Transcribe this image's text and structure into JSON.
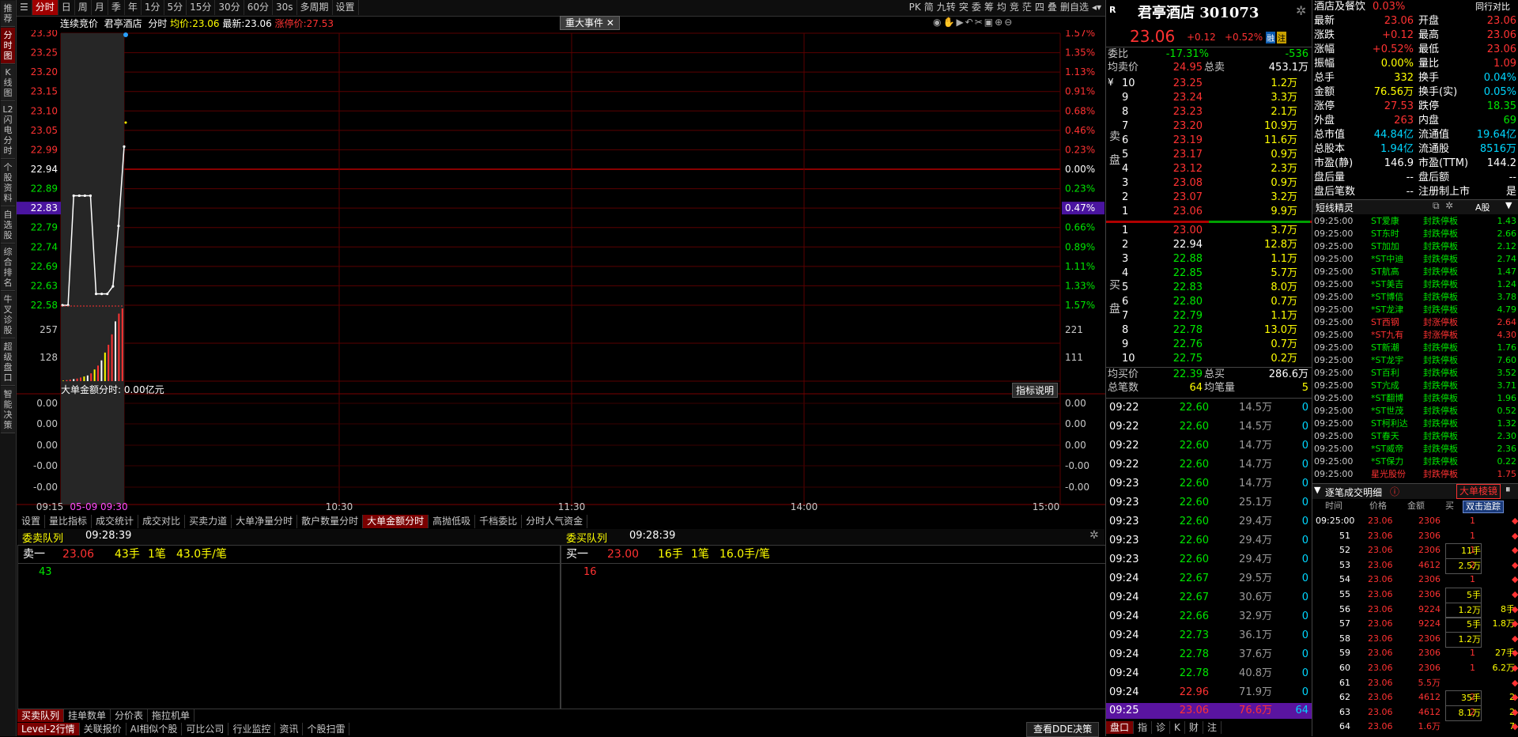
{
  "left_tabs": [
    "推荐",
    "分时图",
    "K线图",
    "L2闪电分时",
    "个股资料",
    "自选股",
    "综合排名",
    "牛叉诊股",
    "超级盘口",
    "智能决策"
  ],
  "toolbar": {
    "items": [
      "分时",
      "日",
      "周",
      "月",
      "季",
      "年",
      "1分",
      "5分",
      "15分",
      "30分",
      "60分",
      "30s",
      "多周期",
      "设置"
    ],
    "right_items": [
      "PK",
      "简",
      "九转",
      "突",
      "委",
      "筹",
      "均",
      "竞",
      "茫",
      "四",
      "叠",
      "删自选"
    ]
  },
  "chart": {
    "mode": "连续竞价",
    "name": "君亭酒店",
    "series_label": "分时",
    "avg_label": "均价:",
    "avg": "23.06",
    "last_label": "最新:",
    "last": "23.06",
    "limit_label": "涨停价:",
    "limit": "27.53",
    "event_btn": "重大事件",
    "price_ticks": [
      "23.30",
      "23.25",
      "23.20",
      "23.15",
      "23.10",
      "23.05",
      "22.99",
      "22.94",
      "22.89",
      "22.83",
      "22.79",
      "22.74",
      "22.69",
      "22.63",
      "22.58"
    ],
    "pct_ticks": [
      "1.57%",
      "1.35%",
      "1.13%",
      "0.91%",
      "0.68%",
      "0.46%",
      "0.23%",
      "0.00%",
      "0.23%",
      "0.47%",
      "0.66%",
      "0.89%",
      "1.11%",
      "1.33%",
      "1.57%"
    ],
    "highlight_price": "22.83",
    "highlight_pct": "0.47%",
    "vol_ticks_left": [
      "257",
      "128"
    ],
    "vol_ticks_right": [
      "221",
      "111"
    ],
    "sub_title": "大单金额分时: 0.00亿元",
    "sub_btn": "指标说明",
    "sub_ticks": [
      "0.00",
      "0.00",
      "0.00",
      "-0.00",
      "-0.00"
    ],
    "time_labels": [
      "09:15",
      "05-09 09:30",
      "10:30",
      "11:30",
      "14:00",
      "15:00"
    ]
  },
  "chart_data": {
    "type": "line",
    "x": [
      "09:15",
      "09:16",
      "09:17",
      "09:18",
      "09:19",
      "09:20",
      "09:21",
      "09:22",
      "09:23",
      "09:24",
      "09:25"
    ],
    "series": [
      {
        "values": [
          22.58,
          22.58,
          22.87,
          22.87,
          22.87,
          22.87,
          22.61,
          22.61,
          22.61,
          22.63,
          22.79,
          23.0
        ]
      }
    ],
    "ylim": [
      22.58,
      23.3
    ],
    "volume": [
      2,
      4,
      6,
      8,
      10,
      14,
      18,
      22,
      30,
      45,
      60,
      80,
      110,
      140,
      180,
      230,
      260,
      280
    ]
  },
  "ind_tabs": [
    "设置",
    "量比指标",
    "成交统计",
    "成交对比",
    "买卖力道",
    "大单净量分时",
    "散户数量分时",
    "大单金额分时",
    "高抛低吸",
    "千档委比",
    "分时人气资金"
  ],
  "ind_active": "大单金额分时",
  "sell_queue": {
    "title": "委卖队列",
    "time": "09:28:39",
    "level": "卖一",
    "price": "23.06",
    "hands": "43手",
    "count": "1笔",
    "avg": "43.0手/笔",
    "entries": [
      "43"
    ]
  },
  "buy_queue": {
    "title": "委买队列",
    "time": "09:28:39",
    "level": "买一",
    "price": "23.00",
    "hands": "16手",
    "count": "1笔",
    "avg": "16.0手/笔",
    "entries": [
      "16"
    ]
  },
  "bottom_tabs1": [
    "买卖队列",
    "挂单数单",
    "分价表",
    "拖拉机单"
  ],
  "bottom_tabs2": [
    "Level-2行情",
    "关联报价",
    "AI相似个股",
    "可比公司",
    "行业监控",
    "资讯",
    "个股扫雷"
  ],
  "dde_btn": "查看DDE决策",
  "stock": {
    "title": "君亭酒店 301073",
    "r_badge": "R",
    "price": "23.06",
    "change": "+0.12",
    "pct": "+0.52%",
    "badge1": "融",
    "badge2": "注",
    "weibi_label": "委比",
    "weibi": "-17.31%",
    "weicha": "-536",
    "avg_sell_label": "均卖价",
    "avg_sell": "24.95",
    "total_sell_label": "总卖",
    "total_sell": "453.1万",
    "sell_side_label": "卖盘",
    "buy_side_label": "买盘",
    "asks": [
      {
        "lv": "10",
        "p": "23.25",
        "v": "1.2万"
      },
      {
        "lv": "9",
        "p": "23.24",
        "v": "3.3万"
      },
      {
        "lv": "8",
        "p": "23.23",
        "v": "2.1万"
      },
      {
        "lv": "7",
        "p": "23.20",
        "v": "10.9万"
      },
      {
        "lv": "6",
        "p": "23.19",
        "v": "11.6万"
      },
      {
        "lv": "5",
        "p": "23.17",
        "v": "0.9万"
      },
      {
        "lv": "4",
        "p": "23.12",
        "v": "2.3万"
      },
      {
        "lv": "3",
        "p": "23.08",
        "v": "0.9万"
      },
      {
        "lv": "2",
        "p": "23.07",
        "v": "3.2万"
      },
      {
        "lv": "1",
        "p": "23.06",
        "v": "9.9万"
      }
    ],
    "bids": [
      {
        "lv": "1",
        "p": "23.00",
        "v": "3.7万"
      },
      {
        "lv": "2",
        "p": "22.94",
        "v": "12.8万"
      },
      {
        "lv": "3",
        "p": "22.88",
        "v": "1.1万"
      },
      {
        "lv": "4",
        "p": "22.85",
        "v": "5.7万"
      },
      {
        "lv": "5",
        "p": "22.83",
        "v": "8.0万"
      },
      {
        "lv": "6",
        "p": "22.80",
        "v": "0.7万"
      },
      {
        "lv": "7",
        "p": "22.79",
        "v": "1.1万"
      },
      {
        "lv": "8",
        "p": "22.78",
        "v": "13.0万"
      },
      {
        "lv": "9",
        "p": "22.76",
        "v": "0.7万"
      },
      {
        "lv": "10",
        "p": "22.75",
        "v": "0.2万"
      }
    ],
    "avg_buy_label": "均买价",
    "avg_buy": "22.39",
    "total_buy_label": "总买",
    "total_buy": "286.6万",
    "total_trades_label": "总笔数",
    "total_trades": "64",
    "avg_vol_label": "均笔量",
    "avg_vol": "5",
    "ticks": [
      {
        "t": "09:22",
        "p": "22.60",
        "v": "14.5万",
        "n": "0"
      },
      {
        "t": "09:22",
        "p": "22.60",
        "v": "14.5万",
        "n": "0"
      },
      {
        "t": "09:22",
        "p": "22.60",
        "v": "14.7万",
        "n": "0"
      },
      {
        "t": "09:22",
        "p": "22.60",
        "v": "14.7万",
        "n": "0"
      },
      {
        "t": "09:23",
        "p": "22.60",
        "v": "14.7万",
        "n": "0"
      },
      {
        "t": "09:23",
        "p": "22.60",
        "v": "25.1万",
        "n": "0"
      },
      {
        "t": "09:23",
        "p": "22.60",
        "v": "29.4万",
        "n": "0"
      },
      {
        "t": "09:23",
        "p": "22.60",
        "v": "29.4万",
        "n": "0"
      },
      {
        "t": "09:23",
        "p": "22.60",
        "v": "29.4万",
        "n": "0"
      },
      {
        "t": "09:24",
        "p": "22.67",
        "v": "29.5万",
        "n": "0"
      },
      {
        "t": "09:24",
        "p": "22.67",
        "v": "30.6万",
        "n": "0"
      },
      {
        "t": "09:24",
        "p": "22.66",
        "v": "32.9万",
        "n": "0"
      },
      {
        "t": "09:24",
        "p": "22.73",
        "v": "36.1万",
        "n": "0"
      },
      {
        "t": "09:24",
        "p": "22.78",
        "v": "37.6万",
        "n": "0"
      },
      {
        "t": "09:24",
        "p": "22.78",
        "v": "40.8万",
        "n": "0"
      },
      {
        "t": "09:24",
        "p": "22.96",
        "v": "71.9万",
        "n": "0"
      }
    ],
    "last_tick": {
      "t": "09:25",
      "p": "23.06",
      "v": "76.6万",
      "n": "64"
    },
    "bottom_tabs": [
      "盘口",
      "指",
      "诊",
      "K",
      "财",
      "注"
    ]
  },
  "stats": {
    "sector": "酒店及餐饮",
    "sector_pct": "0.03%",
    "peer_btn": "同行对比",
    "rows": [
      [
        "最新",
        "23.06",
        "开盘",
        "23.06"
      ],
      [
        "涨跌",
        "+0.12",
        "最高",
        "23.06"
      ],
      [
        "涨幅",
        "+0.52%",
        "最低",
        "23.06"
      ],
      [
        "振幅",
        "0.00%",
        "量比",
        "1.09"
      ],
      [
        "总手",
        "332",
        "换手",
        "0.04%"
      ],
      [
        "金额",
        "76.56万",
        "换手(实)",
        "0.05%"
      ],
      [
        "涨停",
        "27.53",
        "跌停",
        "18.35"
      ],
      [
        "外盘",
        "263",
        "内盘",
        "69"
      ],
      [
        "总市值",
        "44.84亿",
        "流通值",
        "19.64亿"
      ],
      [
        "总股本",
        "1.94亿",
        "流通股",
        "8516万"
      ],
      [
        "市盈(静)",
        "146.9",
        "市盈(TTM)",
        "144.2"
      ],
      [
        "盘后量",
        "--",
        "盘后额",
        "--"
      ],
      [
        "盘后笔数",
        "--",
        "注册制上市",
        "是"
      ]
    ]
  },
  "short_line": {
    "title": "短线精灵",
    "market": "A股",
    "rows": [
      [
        "09:25:00",
        "ST爱康",
        "封跌停板",
        "1.43"
      ],
      [
        "09:25:00",
        "ST东时",
        "封跌停板",
        "2.66"
      ],
      [
        "09:25:00",
        "ST加加",
        "封跌停板",
        "2.12"
      ],
      [
        "09:25:00",
        "*ST中迪",
        "封跌停板",
        "2.74"
      ],
      [
        "09:25:00",
        "ST航高",
        "封跌停板",
        "1.47"
      ],
      [
        "09:25:00",
        "*ST美吉",
        "封跌停板",
        "1.24"
      ],
      [
        "09:25:00",
        "*ST博信",
        "封跌停板",
        "3.78"
      ],
      [
        "09:25:00",
        "*ST龙津",
        "封跌停板",
        "4.79"
      ],
      [
        "09:25:00",
        "ST西钢",
        "封涨停板",
        "2.64"
      ],
      [
        "09:25:00",
        "*ST九有",
        "封涨停板",
        "4.30"
      ],
      [
        "09:25:00",
        "ST新潮",
        "封跌停板",
        "1.76"
      ],
      [
        "09:25:00",
        "*ST龙宇",
        "封跌停板",
        "7.60"
      ],
      [
        "09:25:00",
        "ST百利",
        "封跌停板",
        "3.52"
      ],
      [
        "09:25:00",
        "ST亢成",
        "封跌停板",
        "3.71"
      ],
      [
        "09:25:00",
        "*ST翻博",
        "封跌停板",
        "1.96"
      ],
      [
        "09:25:00",
        "*ST世茂",
        "封跌停板",
        "0.52"
      ],
      [
        "09:25:00",
        "ST柯利达",
        "封跌停板",
        "1.32"
      ],
      [
        "09:25:00",
        "ST春天",
        "封跌停板",
        "2.30"
      ],
      [
        "09:25:00",
        "*ST威帝",
        "封跌停板",
        "2.36"
      ],
      [
        "09:25:00",
        "*ST保力",
        "封跌停板",
        "0.22"
      ],
      [
        "09:25:00",
        "星光股份",
        "封跌停板",
        "1.75"
      ]
    ],
    "red_rows": [
      8,
      9,
      20
    ]
  },
  "deal_detail": {
    "title": "逐笔成交明细",
    "big_btn": "大单棱镜",
    "dbl_btn": "双击追踪",
    "headers": [
      "时间",
      "价格",
      "金额",
      "买"
    ],
    "rows": [
      [
        "09:25:00",
        "23.06",
        "2306",
        "1",
        "",
        ""
      ],
      [
        "51",
        "23.06",
        "2306",
        "1",
        "",
        ""
      ],
      [
        "52",
        "23.06",
        "2306",
        "1",
        "11手",
        ""
      ],
      [
        "53",
        "23.06",
        "4612",
        "2",
        "2.5万",
        ""
      ],
      [
        "54",
        "23.06",
        "2306",
        "1",
        "",
        ""
      ],
      [
        "55",
        "23.06",
        "2306",
        "",
        "5手",
        ""
      ],
      [
        "56",
        "23.06",
        "9224",
        "",
        "1.2万",
        "8手"
      ],
      [
        "57",
        "23.06",
        "9224",
        "",
        "5手",
        "1.8万"
      ],
      [
        "58",
        "23.06",
        "2306",
        "",
        "1.2万",
        ""
      ],
      [
        "59",
        "23.06",
        "2306",
        "1",
        "",
        "27手"
      ],
      [
        "60",
        "23.06",
        "2306",
        "1",
        "",
        "6.2万"
      ],
      [
        "61",
        "23.06",
        "5.5万",
        "",
        "",
        ""
      ],
      [
        "62",
        "23.06",
        "4612",
        "2",
        "35手",
        "2"
      ],
      [
        "63",
        "23.06",
        "4612",
        "2",
        "8.1万",
        "2"
      ],
      [
        "64",
        "23.06",
        "1.6万",
        "",
        "",
        "7"
      ]
    ]
  }
}
